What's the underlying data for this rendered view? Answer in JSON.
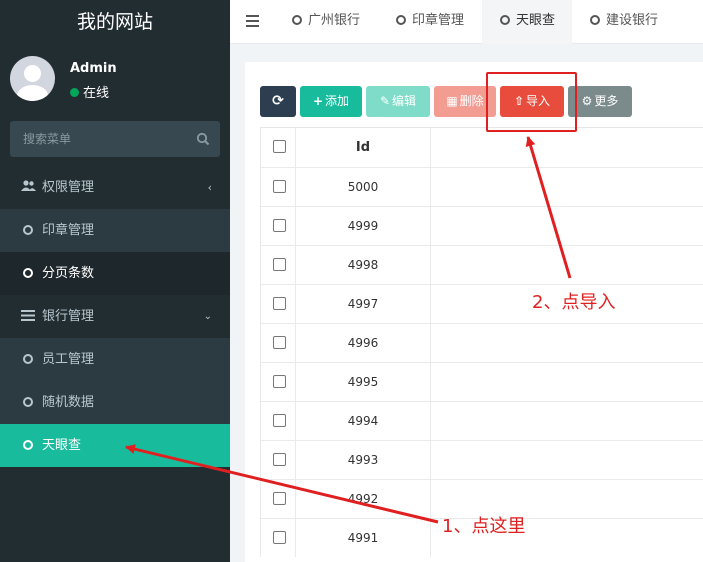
{
  "sidebar": {
    "brand": "我的网站",
    "user": {
      "name": "Admin",
      "status": "在线"
    },
    "search": {
      "placeholder": "搜索菜单"
    },
    "items": [
      {
        "label": "权限管理",
        "icon": "users-icon"
      },
      {
        "label": "印章管理",
        "icon": "circle-icon"
      },
      {
        "label": "分页条数",
        "icon": "circle-icon"
      },
      {
        "label": "银行管理",
        "icon": "list-icon"
      },
      {
        "label": "员工管理",
        "icon": "circle-icon"
      },
      {
        "label": "随机数据",
        "icon": "circle-icon"
      },
      {
        "label": "天眼查",
        "icon": "circle-icon"
      }
    ]
  },
  "tabs": [
    {
      "label": "广州银行"
    },
    {
      "label": "印章管理"
    },
    {
      "label": "天眼查"
    },
    {
      "label": "建设银行"
    }
  ],
  "toolbar": {
    "add": "添加",
    "edit": "编辑",
    "delete": "删除",
    "import": "导入",
    "more": "更多"
  },
  "table": {
    "columns": [
      "Id"
    ],
    "rows": [
      {
        "id": "5000"
      },
      {
        "id": "4999"
      },
      {
        "id": "4998"
      },
      {
        "id": "4997"
      },
      {
        "id": "4996"
      },
      {
        "id": "4995"
      },
      {
        "id": "4994"
      },
      {
        "id": "4993"
      },
      {
        "id": "4992"
      },
      {
        "id": "4991"
      }
    ]
  },
  "annotations": {
    "step1": "1、点这里",
    "step2": "2、点导入"
  },
  "colors": {
    "sidebar_bg": "#222d32",
    "active": "#18bc9c",
    "danger": "#e74c3c",
    "annotation": "#e02020"
  }
}
